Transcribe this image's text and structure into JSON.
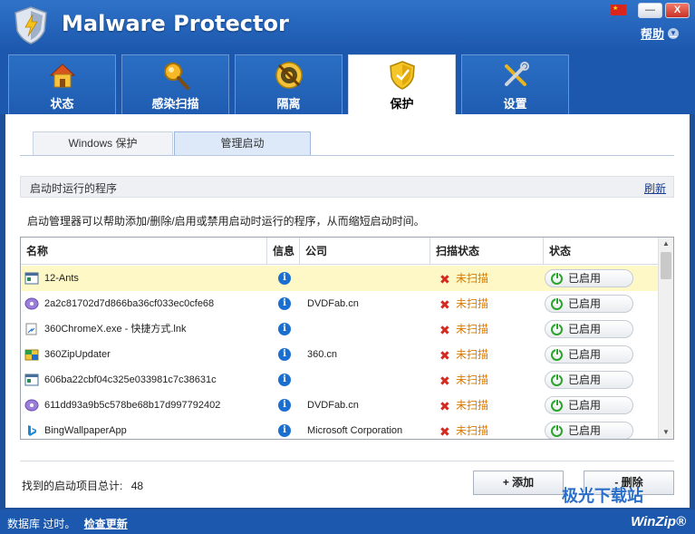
{
  "app": {
    "title": "Malware Protector",
    "help": "帮助"
  },
  "window_buttons": {
    "minimize": "—",
    "close": "X"
  },
  "main_tabs": [
    {
      "label": "状态",
      "icon": "home-icon"
    },
    {
      "label": "感染扫描",
      "icon": "magnifier-icon"
    },
    {
      "label": "隔离",
      "icon": "quarantine-icon"
    },
    {
      "label": "保护",
      "icon": "shield-icon",
      "active": true
    },
    {
      "label": "设置",
      "icon": "tools-icon"
    }
  ],
  "sub_tabs": [
    {
      "label": "Windows 保护"
    },
    {
      "label": "管理启动",
      "active": true
    }
  ],
  "section": {
    "title": "启动时运行的程序",
    "refresh": "刷新",
    "description": "启动管理器可以帮助添加/删除/启用或禁用启动时运行的程序，从而缩短启动时间。"
  },
  "table": {
    "headers": {
      "name": "名称",
      "info": "信息",
      "company": "公司",
      "scan_status": "扫描状态",
      "status": "状态"
    },
    "rows": [
      {
        "name": "12-Ants",
        "company": "",
        "scan": "未扫描",
        "status": "已启用",
        "icon": "window-icon",
        "selected": true
      },
      {
        "name": "2a2c81702d7d866ba36cf033ec0cfe68",
        "company": "DVDFab.cn",
        "scan": "未扫描",
        "status": "已启用",
        "icon": "disc-icon"
      },
      {
        "name": "360ChromeX.exe - 快捷方式.lnk",
        "company": "",
        "scan": "未扫描",
        "status": "已启用",
        "icon": "shortcut-icon"
      },
      {
        "name": "360ZipUpdater",
        "company": "360.cn",
        "scan": "未扫描",
        "status": "已启用",
        "icon": "zip-icon"
      },
      {
        "name": "606ba22cbf04c325e033981c7c38631c",
        "company": "",
        "scan": "未扫描",
        "status": "已启用",
        "icon": "window-icon"
      },
      {
        "name": "611dd93a9b5c578be68b17d997792402",
        "company": "DVDFab.cn",
        "scan": "未扫描",
        "status": "已启用",
        "icon": "disc-icon"
      },
      {
        "name": "BingWallpaperApp",
        "company": "Microsoft Corporation",
        "scan": "未扫描",
        "status": "已启用",
        "icon": "bing-icon"
      }
    ]
  },
  "footer": {
    "total_label": "找到的启动项目总计:",
    "total_value": "48",
    "add_button": "+  添加",
    "delete_button": "-  删除"
  },
  "statusbar": {
    "db_text": "数据库 过时。",
    "update_link": "检查更新",
    "brand": "WinZip®",
    "watermark": "极光下载站"
  },
  "colors": {
    "header_blue": "#1c58ae",
    "not_scanned": "#d97a00",
    "enabled_green": "#2aa52a"
  }
}
